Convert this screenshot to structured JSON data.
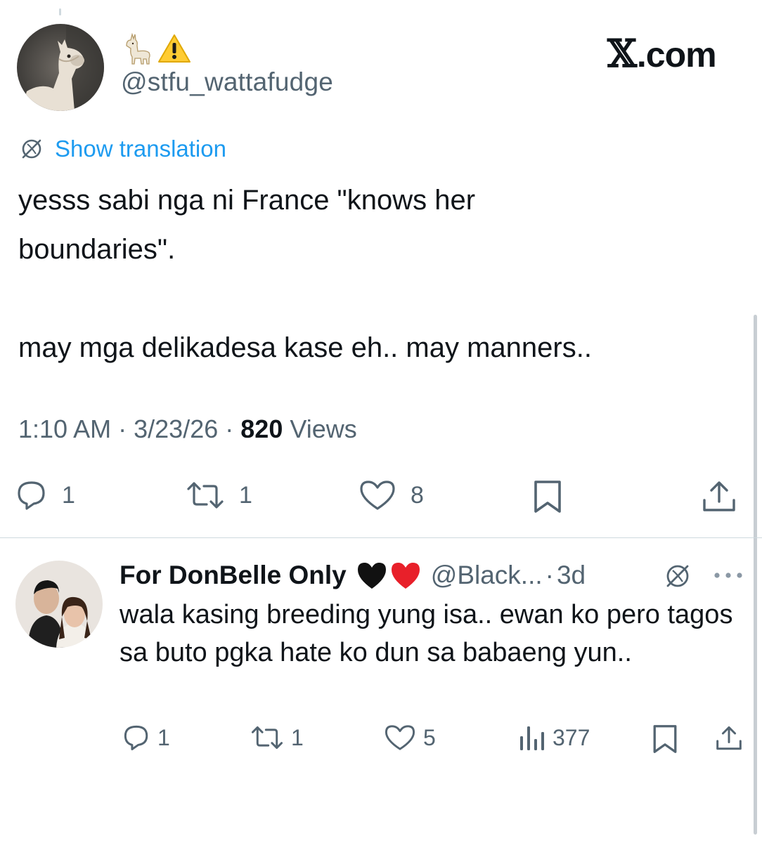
{
  "watermark": "X.com",
  "tweet": {
    "display_name_emojis": [
      "llama-emoji",
      "warning-emoji"
    ],
    "handle": "@stfu_wattafudge",
    "show_translation": "Show translation",
    "text": "yesss sabi nga ni France \"knows her\nboundaries\".\n\nmay mga delikadesa kase eh.. may manners..",
    "time": "1:10 AM",
    "date": "3/23/26",
    "views_count": "820",
    "views_label": "Views",
    "dot": "·",
    "replies": "1",
    "reposts": "1",
    "likes": "8"
  },
  "reply": {
    "name": "For DonBelle Only",
    "name_emojis": [
      "black-heart-emoji",
      "red-heart-emoji"
    ],
    "handle": "@Black...",
    "dot": "·",
    "time": "3d",
    "text": "wala kasing breeding yung isa.. ewan ko pero tagos sa buto pgka hate ko dun sa babaeng yun..",
    "replies": "1",
    "reposts": "1",
    "likes": "5",
    "views": "377"
  },
  "colors": {
    "text": "#0f1419",
    "secondary": "#536471",
    "link": "#1d9bf0",
    "divider": "#cfd9de"
  }
}
